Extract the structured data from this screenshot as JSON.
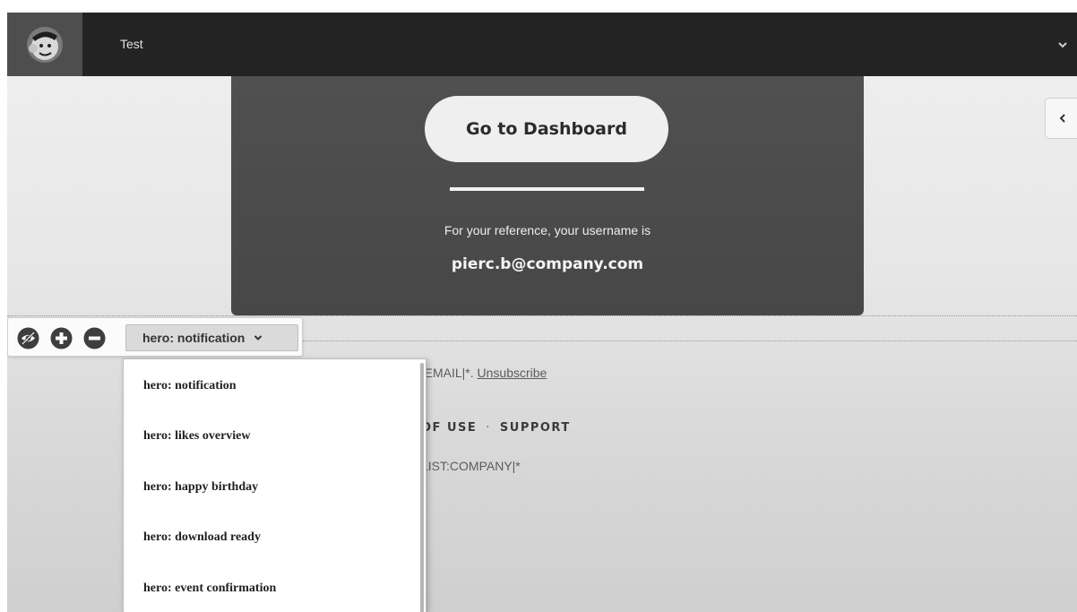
{
  "header": {
    "app_title": "Test"
  },
  "hero": {
    "cta_label": "Go to Dashboard",
    "reference_text": "For your reference, your username is",
    "username": "pierc.b@company.com"
  },
  "section_toolbar": {
    "selected_section": "hero: notification"
  },
  "footer": {
    "email_text": "|EMAIL|*. ",
    "unsubscribe_label": "Unsubscribe",
    "terms_fragment": "OF USE",
    "support_label": "SUPPORT",
    "list_company": "LIST:COMPANY|*"
  },
  "dropdown": {
    "options": [
      "hero: notification",
      "hero: likes overview",
      "hero: happy birthday",
      "hero: download ready",
      "hero: event confirmation"
    ]
  },
  "icons": {
    "logo": "monkey-logo-icon",
    "top_right": "chevron-down-icon",
    "side_tab": "chevron-left-icon",
    "toolbar": [
      "eye-slash-icon",
      "plus-circle-icon",
      "minus-circle-icon"
    ]
  },
  "colors": {
    "topbar": "#232323",
    "logo_bg": "#4e4e4e",
    "hero_card": "#4c4c4c",
    "cta_button": "#efefef"
  }
}
